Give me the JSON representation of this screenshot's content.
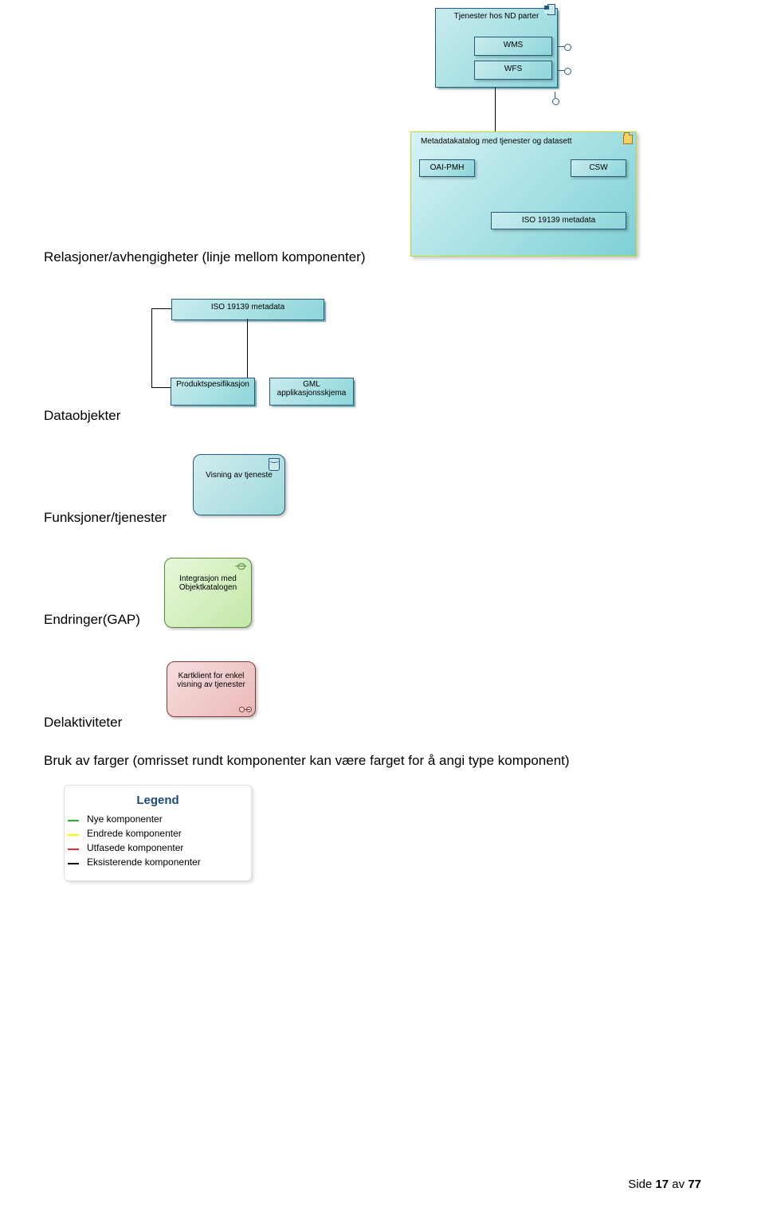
{
  "top_component": {
    "title": "Tjenester hos ND parter",
    "services": [
      "WMS",
      "WFS"
    ]
  },
  "catalog": {
    "title": "Metadatakatalog med tjenester og datasett",
    "ports": [
      "OAI-PMH",
      "CSW"
    ],
    "inner": "ISO 19139 metadata"
  },
  "sections": {
    "relations": "Relasjoner/avhengigheter (linje  mellom komponenter)",
    "dataobjects": "Dataobjekter",
    "functions": "Funksjoner/tjenester",
    "gap": "Endringer(GAP)",
    "deliverables": "Delaktiviteter"
  },
  "iso_box": "ISO 19139 metadata",
  "prodspec": "Produktspesifikasjon",
  "gml": {
    "line1": "GML",
    "line2": "applikasjonsskjema"
  },
  "visning": "Visning av tjeneste",
  "integrasjon": {
    "line1": "Integrasjon med",
    "line2": "Objektkatalogen"
  },
  "kartklient": {
    "line1": "Kartklient for enkel",
    "line2": "visning av tjenester"
  },
  "color_text": "Bruk av farger (omrisset rundt komponenter kan være farget for å angi type komponent)",
  "legend": {
    "title": "Legend",
    "items": [
      {
        "label": "Nye komponenter",
        "color": "green"
      },
      {
        "label": "Endrede komponenter",
        "color": "yellow"
      },
      {
        "label": "Utfasede komponenter",
        "color": "red"
      },
      {
        "label": "Eksisterende komponenter",
        "color": "black"
      }
    ]
  },
  "footer": {
    "prefix": "Side ",
    "page": "17",
    "of": " av ",
    "total": "77"
  }
}
